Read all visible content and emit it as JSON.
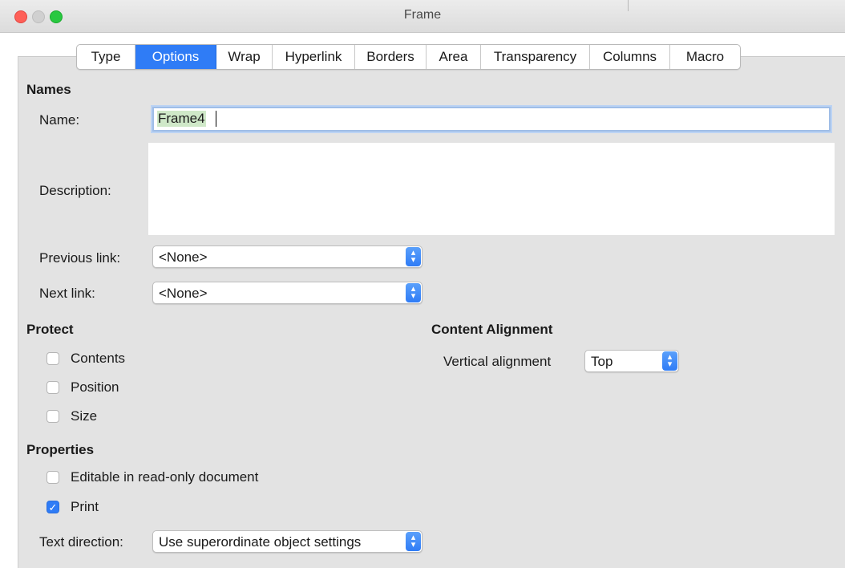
{
  "window": {
    "title": "Frame"
  },
  "tabs": [
    "Type",
    "Options",
    "Wrap",
    "Hyperlink",
    "Borders",
    "Area",
    "Transparency",
    "Columns",
    "Macro"
  ],
  "active_tab": "Options",
  "names": {
    "heading": "Names",
    "name_label": "Name:",
    "name_value": "Frame4",
    "description_label": "Description:",
    "description_value": "",
    "previous_link_label": "Previous link:",
    "previous_link_value": "<None>",
    "next_link_label": "Next link:",
    "next_link_value": "<None>"
  },
  "protect": {
    "heading": "Protect",
    "items": [
      {
        "label": "Contents",
        "checked": false
      },
      {
        "label": "Position",
        "checked": false
      },
      {
        "label": "Size",
        "checked": false
      }
    ]
  },
  "content_alignment": {
    "heading": "Content Alignment",
    "vertical_label": "Vertical alignment",
    "vertical_value": "Top"
  },
  "properties": {
    "heading": "Properties",
    "items": [
      {
        "label": "Editable in read-only document",
        "checked": false
      },
      {
        "label": "Print",
        "checked": true
      }
    ],
    "text_direction_label": "Text direction:",
    "text_direction_value": "Use superordinate object settings"
  },
  "colors": {
    "accent": "#2f7cf6",
    "panel": "#e3e3e3",
    "selection": "#cfe8c8"
  }
}
